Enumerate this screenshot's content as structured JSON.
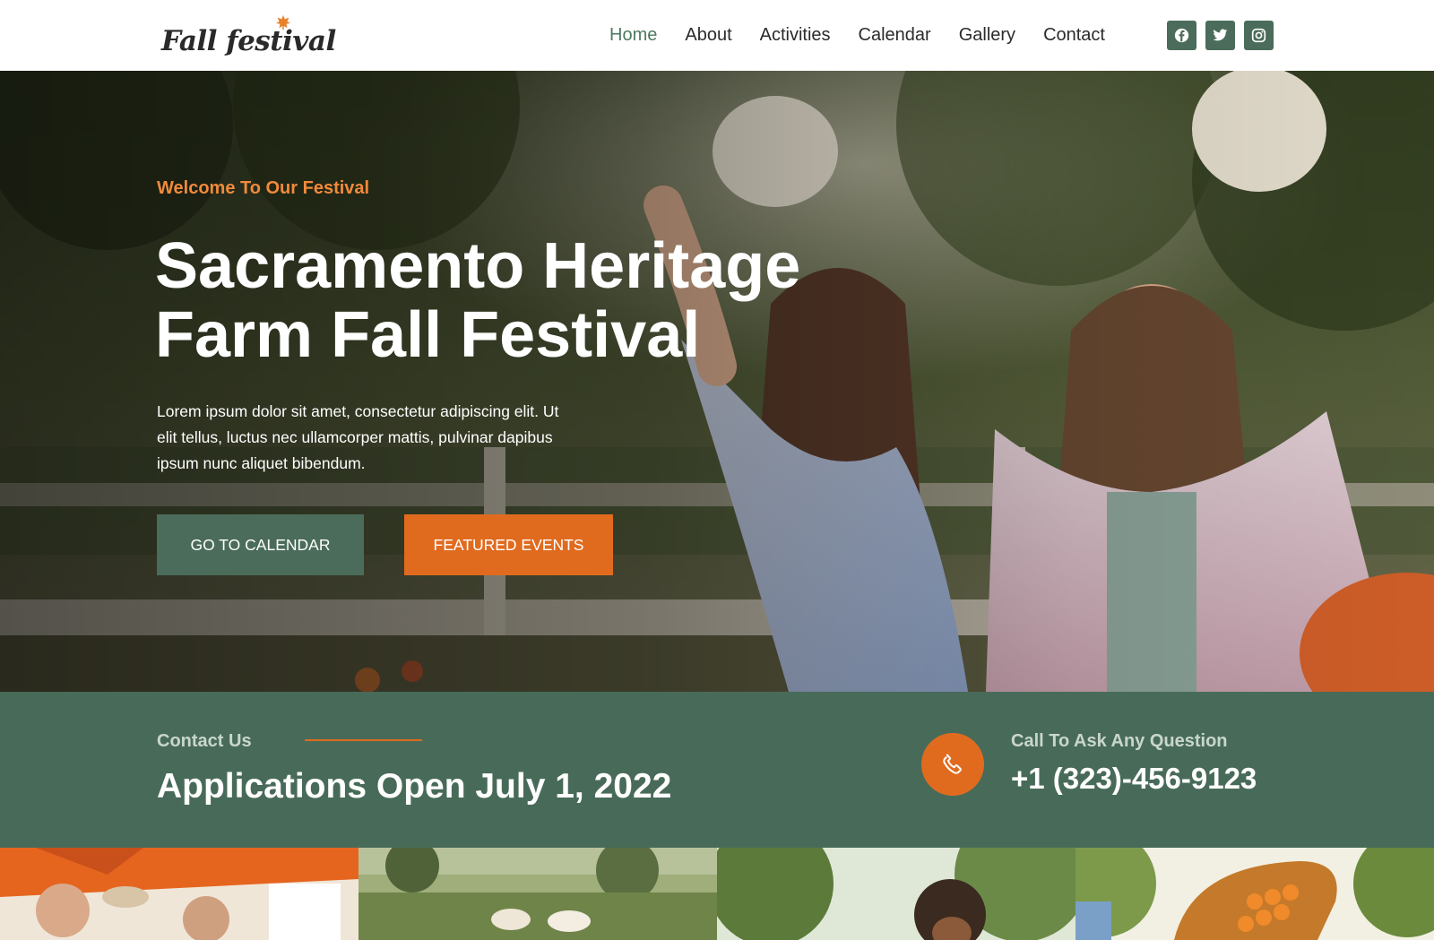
{
  "header": {
    "logo_text": "Fall festival",
    "nav": [
      {
        "label": "Home",
        "active": true
      },
      {
        "label": "About",
        "active": false
      },
      {
        "label": "Activities",
        "active": false
      },
      {
        "label": "Calendar",
        "active": false
      },
      {
        "label": "Gallery",
        "active": false
      },
      {
        "label": "Contact",
        "active": false
      }
    ],
    "social": [
      "facebook-icon",
      "twitter-icon",
      "instagram-icon"
    ]
  },
  "hero": {
    "kicker": "Welcome To Our Festival",
    "title": "Sacramento Heritage Farm Fall Festival",
    "description": "Lorem ipsum dolor sit amet, consectetur adipiscing elit. Ut elit tellus, luctus nec ullamcorper mattis, pulvinar dapibus ipsum nunc aliquet bibendum.",
    "primary_button": "GO TO CALENDAR",
    "secondary_button": "FEATURED EVENTS"
  },
  "contact_band": {
    "label": "Contact Us",
    "title": "Applications Open July 1, 2022",
    "call_label": "Call To Ask Any Question",
    "phone": "+1 (323)-456-9123"
  },
  "colors": {
    "green": "#4b6c5a",
    "band_green": "#486b59",
    "orange": "#e06b1f",
    "kicker_orange": "#f08a3c",
    "nav_active": "#4d7a62"
  }
}
